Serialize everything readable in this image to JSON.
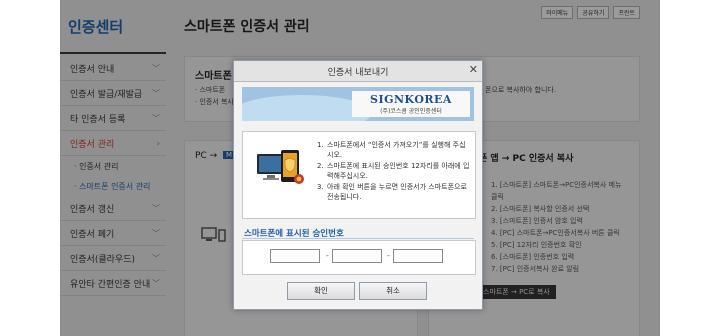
{
  "sidebar": {
    "title": "인증센터",
    "items": [
      {
        "label": "인증서 안내",
        "chevron": "﹀"
      },
      {
        "label": "인증서 발급/재발급",
        "chevron": "﹀"
      },
      {
        "label": "타 인증서 등록",
        "chevron": "﹀"
      },
      {
        "label": "인증서 관리",
        "chevron": "›"
      },
      {
        "label": "· 인증서 관리"
      },
      {
        "label": "· 스마트폰 인증서 관리"
      },
      {
        "label": "인증서 갱신",
        "chevron": "﹀"
      },
      {
        "label": "인증서 폐기",
        "chevron": "﹀"
      },
      {
        "label": "인증서(클라우드)",
        "chevron": "﹀"
      },
      {
        "label": "유안타 간편인증 안내",
        "chevron": "﹀"
      }
    ]
  },
  "top_links": [
    "마이메뉴",
    "공유하기",
    "프린트"
  ],
  "main": {
    "title": "스마트폰 인증서 관리",
    "info_heading": "스마트폰",
    "info_lines": [
      "· 스마트폰",
      "· 인증서 복사"
    ],
    "info_right": "폰으로 복사하야 합니다.",
    "left_panel": {
      "head": "PC →",
      "chip": "M"
    },
    "right_panel": {
      "head": "폰 앱 → PC 인증서 복사",
      "steps": [
        "1. [스마트폰] 스마트폰→PC인증서복사 메뉴",
        "클릭",
        "2. [스마트폰] 복사할 인증서 선택",
        "3. [스마트폰] 인증서 암호 입력",
        "4. [PC] 스마트폰→PC인증서복사 버튼 클릭",
        "5. [PC] 12자리 인증번호 확인",
        "6. [스마트폰] 인증번호 입력",
        "7. [PC] 인증서복사 완료 알림"
      ],
      "button": "스마트폰 → PC로 복사"
    }
  },
  "dialog": {
    "title": "인증서 내보내기",
    "close": "✕",
    "brand": "SIGNKOREA",
    "brand_sub": "(주)코스콤 공인인증센터",
    "steps": [
      {
        "num": "1.",
        "text": "스마트폰에서 “인증서 가져오기”를 실행해 주십시오."
      },
      {
        "num": "2.",
        "text": "스마트폰에 표시된 승인번호 12자리를 아래에 입력해주십시오."
      },
      {
        "num": "3.",
        "text": "아래 확인 버튼을 누르면 인증서가 스마트폰으로 전송됩니다."
      }
    ],
    "code_label": "스마트폰에 표시된 승인번호",
    "code_inputs": [
      "",
      "",
      ""
    ],
    "dash": "-",
    "confirm": "확인",
    "cancel": "취소"
  }
}
